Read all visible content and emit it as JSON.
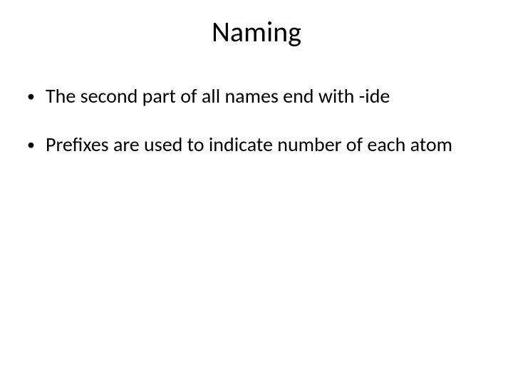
{
  "slide": {
    "title": "Naming",
    "bullets": [
      "The second part of all names end with -ide",
      "Prefixes are used to indicate number of each atom"
    ]
  }
}
